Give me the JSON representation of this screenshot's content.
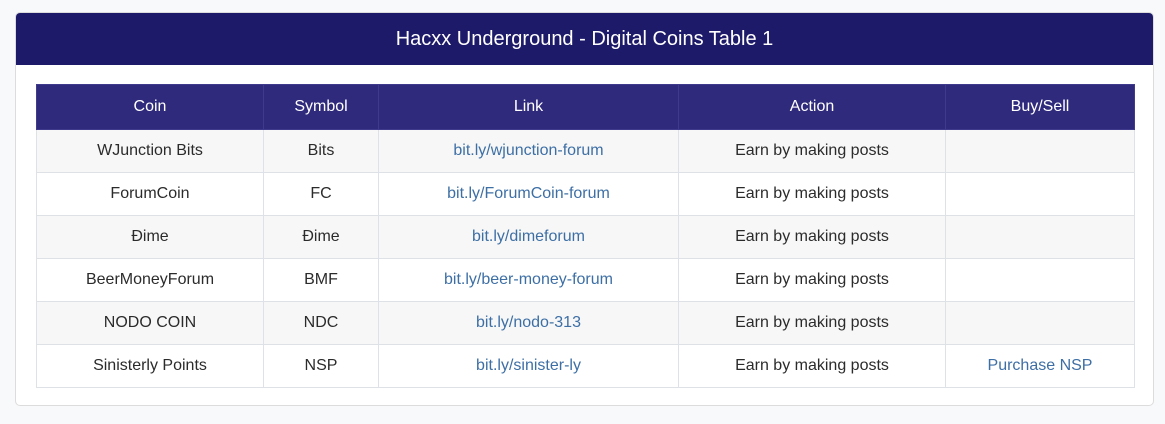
{
  "header": {
    "title": "Hacxx Underground - Digital Coins Table 1"
  },
  "table": {
    "columns": [
      "Coin",
      "Symbol",
      "Link",
      "Action",
      "Buy/Sell"
    ],
    "rows": [
      {
        "coin": "WJunction Bits",
        "symbol": "Bits",
        "link": "bit.ly/wjunction-forum",
        "action": "Earn by making posts",
        "buy_sell": ""
      },
      {
        "coin": "ForumCoin",
        "symbol": "FC",
        "link": "bit.ly/ForumCoin-forum",
        "action": "Earn by making posts",
        "buy_sell": ""
      },
      {
        "coin": "Đime",
        "symbol": "Đime",
        "link": "bit.ly/dimeforum",
        "action": "Earn by making posts",
        "buy_sell": ""
      },
      {
        "coin": "BeerMoneyForum",
        "symbol": "BMF",
        "link": "bit.ly/beer-money-forum",
        "action": "Earn by making posts",
        "buy_sell": ""
      },
      {
        "coin": "NODO COIN",
        "symbol": "NDC",
        "link": "bit.ly/nodo-313",
        "action": "Earn by making posts",
        "buy_sell": ""
      },
      {
        "coin": "Sinisterly Points",
        "symbol": "NSP",
        "link": "bit.ly/sinister-ly",
        "action": "Earn by making posts",
        "buy_sell": "Purchase NSP"
      }
    ]
  },
  "colors": {
    "header_bg": "#1d1a6a",
    "table_head_bg": "#2f2a7c",
    "link": "#3d6fa5"
  }
}
